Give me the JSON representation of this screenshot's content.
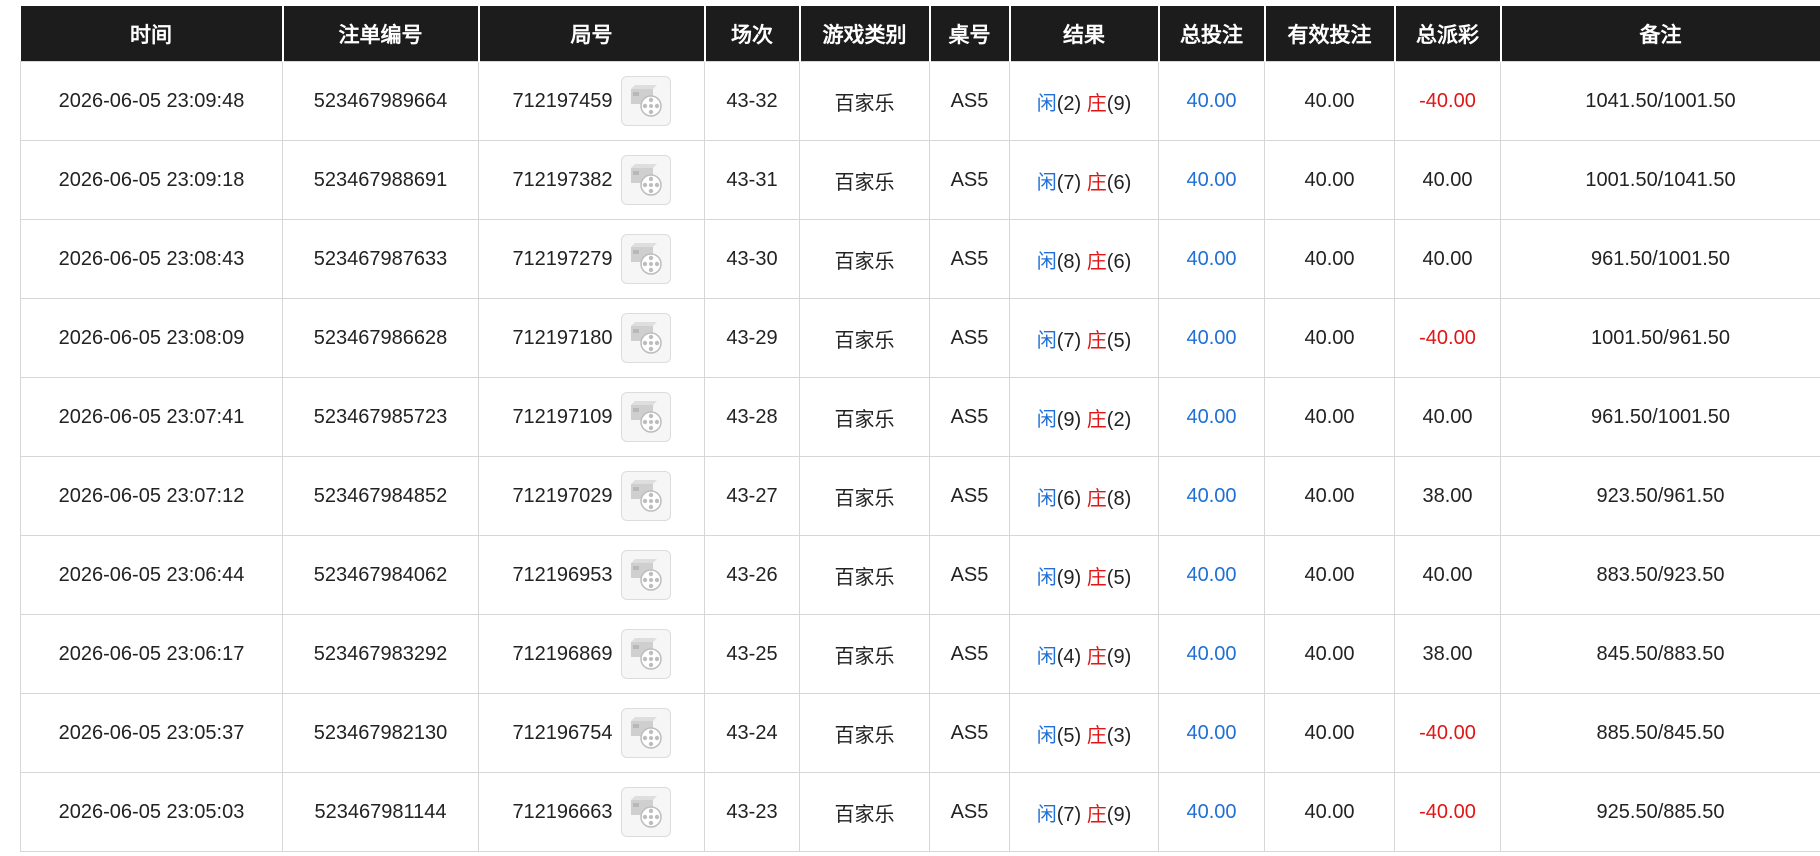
{
  "columns": [
    "时间",
    "注单编号",
    "局号",
    "场次",
    "游戏类别",
    "桌号",
    "结果",
    "总投注",
    "有效投注",
    "总派彩",
    "备注"
  ],
  "icons": {
    "video": "video-replay-icon"
  },
  "colors": {
    "header_bg": "#1c1c1c",
    "positive_bet": "#1f6fd6",
    "negative_payout": "#e01515"
  },
  "rows": [
    {
      "time": "2026-06-05 23:09:48",
      "bet_no": "523467989664",
      "round_no": "712197459",
      "session": "43-32",
      "game": "百家乐",
      "table": "AS5",
      "player_label": "闲",
      "player_score": "(2)",
      "banker_label": "庄",
      "banker_score": "(9)",
      "total_bet": "40.00",
      "valid_bet": "40.00",
      "payout": "-40.00",
      "payout_negative": true,
      "note": "1041.50/1001.50"
    },
    {
      "time": "2026-06-05 23:09:18",
      "bet_no": "523467988691",
      "round_no": "712197382",
      "session": "43-31",
      "game": "百家乐",
      "table": "AS5",
      "player_label": "闲",
      "player_score": "(7)",
      "banker_label": "庄",
      "banker_score": "(6)",
      "total_bet": "40.00",
      "valid_bet": "40.00",
      "payout": "40.00",
      "payout_negative": false,
      "note": "1001.50/1041.50"
    },
    {
      "time": "2026-06-05 23:08:43",
      "bet_no": "523467987633",
      "round_no": "712197279",
      "session": "43-30",
      "game": "百家乐",
      "table": "AS5",
      "player_label": "闲",
      "player_score": "(8)",
      "banker_label": "庄",
      "banker_score": "(6)",
      "total_bet": "40.00",
      "valid_bet": "40.00",
      "payout": "40.00",
      "payout_negative": false,
      "note": "961.50/1001.50"
    },
    {
      "time": "2026-06-05 23:08:09",
      "bet_no": "523467986628",
      "round_no": "712197180",
      "session": "43-29",
      "game": "百家乐",
      "table": "AS5",
      "player_label": "闲",
      "player_score": "(7)",
      "banker_label": "庄",
      "banker_score": "(5)",
      "total_bet": "40.00",
      "valid_bet": "40.00",
      "payout": "-40.00",
      "payout_negative": true,
      "note": "1001.50/961.50"
    },
    {
      "time": "2026-06-05 23:07:41",
      "bet_no": "523467985723",
      "round_no": "712197109",
      "session": "43-28",
      "game": "百家乐",
      "table": "AS5",
      "player_label": "闲",
      "player_score": "(9)",
      "banker_label": "庄",
      "banker_score": "(2)",
      "total_bet": "40.00",
      "valid_bet": "40.00",
      "payout": "40.00",
      "payout_negative": false,
      "note": "961.50/1001.50"
    },
    {
      "time": "2026-06-05 23:07:12",
      "bet_no": "523467984852",
      "round_no": "712197029",
      "session": "43-27",
      "game": "百家乐",
      "table": "AS5",
      "player_label": "闲",
      "player_score": "(6)",
      "banker_label": "庄",
      "banker_score": "(8)",
      "total_bet": "40.00",
      "valid_bet": "40.00",
      "payout": "38.00",
      "payout_negative": false,
      "note": "923.50/961.50"
    },
    {
      "time": "2026-06-05 23:06:44",
      "bet_no": "523467984062",
      "round_no": "712196953",
      "session": "43-26",
      "game": "百家乐",
      "table": "AS5",
      "player_label": "闲",
      "player_score": "(9)",
      "banker_label": "庄",
      "banker_score": "(5)",
      "total_bet": "40.00",
      "valid_bet": "40.00",
      "payout": "40.00",
      "payout_negative": false,
      "note": "883.50/923.50"
    },
    {
      "time": "2026-06-05 23:06:17",
      "bet_no": "523467983292",
      "round_no": "712196869",
      "session": "43-25",
      "game": "百家乐",
      "table": "AS5",
      "player_label": "闲",
      "player_score": "(4)",
      "banker_label": "庄",
      "banker_score": "(9)",
      "total_bet": "40.00",
      "valid_bet": "40.00",
      "payout": "38.00",
      "payout_negative": false,
      "note": "845.50/883.50"
    },
    {
      "time": "2026-06-05 23:05:37",
      "bet_no": "523467982130",
      "round_no": "712196754",
      "session": "43-24",
      "game": "百家乐",
      "table": "AS5",
      "player_label": "闲",
      "player_score": "(5)",
      "banker_label": "庄",
      "banker_score": "(3)",
      "total_bet": "40.00",
      "valid_bet": "40.00",
      "payout": "-40.00",
      "payout_negative": true,
      "note": "885.50/845.50"
    },
    {
      "time": "2026-06-05 23:05:03",
      "bet_no": "523467981144",
      "round_no": "712196663",
      "session": "43-23",
      "game": "百家乐",
      "table": "AS5",
      "player_label": "闲",
      "player_score": "(7)",
      "banker_label": "庄",
      "banker_score": "(9)",
      "total_bet": "40.00",
      "valid_bet": "40.00",
      "payout": "-40.00",
      "payout_negative": true,
      "note": "925.50/885.50"
    }
  ]
}
